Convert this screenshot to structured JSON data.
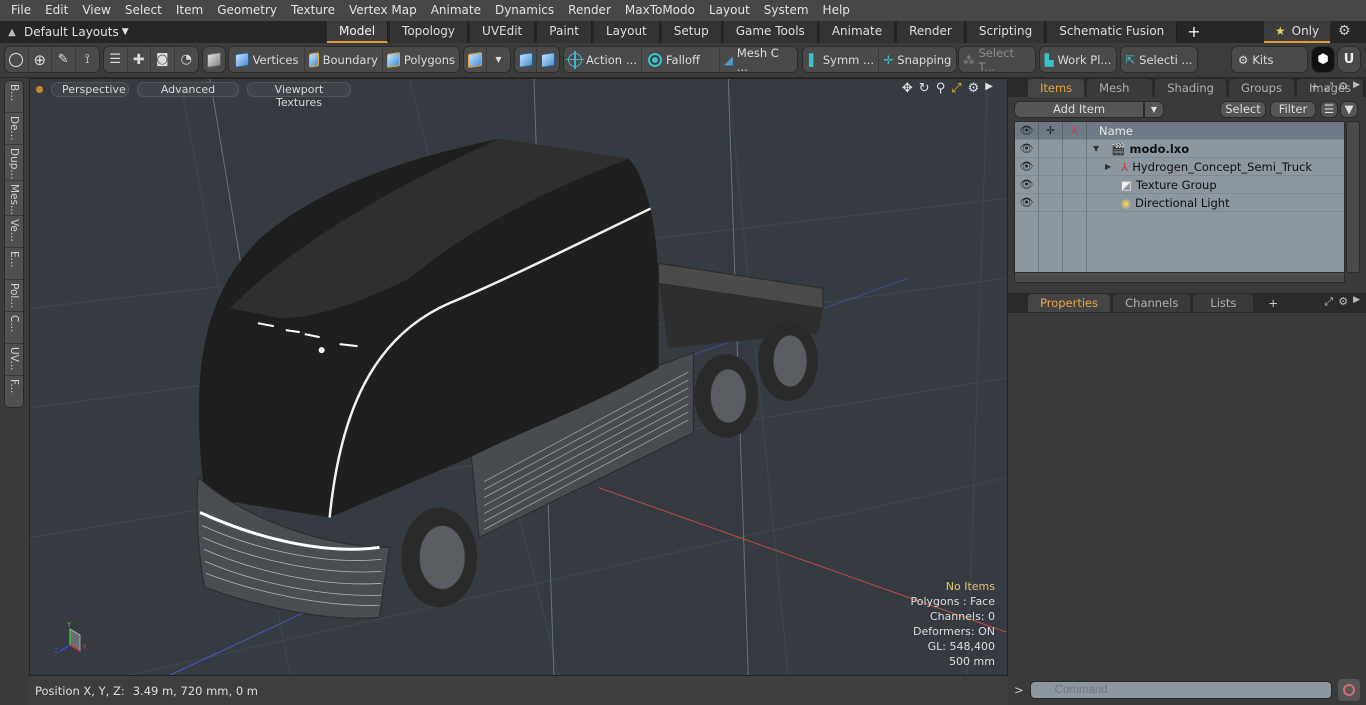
{
  "menu": [
    "File",
    "Edit",
    "View",
    "Select",
    "Item",
    "Geometry",
    "Texture",
    "Vertex Map",
    "Animate",
    "Dynamics",
    "Render",
    "MaxToModo",
    "Layout",
    "System",
    "Help"
  ],
  "layoutbar": {
    "layout_select": "Default Layouts",
    "tabs": [
      {
        "label": "Model",
        "active": true
      },
      {
        "label": "Topology"
      },
      {
        "label": "UVEdit"
      },
      {
        "label": "Paint"
      },
      {
        "label": "Layout"
      },
      {
        "label": "Setup"
      },
      {
        "label": "Game Tools"
      },
      {
        "label": "Animate"
      },
      {
        "label": "Render"
      },
      {
        "label": "Scripting"
      },
      {
        "label": "Schematic Fusion"
      }
    ],
    "add_tab": "+",
    "only_label": "Only"
  },
  "toolbar": {
    "vertices": "Vertices",
    "boundary": "Boundary",
    "polygons": "Polygons",
    "action": "Action",
    "action_more": "...",
    "falloff": "Falloff",
    "mesh": "Mesh C ...",
    "symmetry": "Symm ...",
    "snapping": "Snapping",
    "select_through": "Select T...",
    "work_plane": "Work Pl...",
    "selection": "Selecti ...",
    "kits": "Kits"
  },
  "left_tabs": [
    "B...",
    "De...",
    "Dup...",
    "Mes...",
    "Ve...",
    "E...",
    "Pol...",
    "C...",
    "UV...",
    "F..."
  ],
  "viewport": {
    "perspective": "Perspective",
    "advanced": "Advanced",
    "textures": "Viewport Textures",
    "info": {
      "selection": "No Items",
      "polygons": "Polygons : Face",
      "channels": "Channels: 0",
      "deformers": "Deformers: ON",
      "gl": "GL: 548,400",
      "scale": "500 mm"
    },
    "axis_labels": {
      "x": "X",
      "y": "Y",
      "z": "Z"
    }
  },
  "statusbar": {
    "position_label": "Position X, Y, Z:",
    "position_value": "3.49 m, 720 mm, 0 m"
  },
  "items_panel": {
    "tabs": [
      {
        "label": "Items",
        "active": true
      },
      {
        "label": "Mesh ..."
      },
      {
        "label": "Shading"
      },
      {
        "label": "Groups"
      },
      {
        "label": "Images"
      }
    ],
    "add_item": "Add Item",
    "select": "Select",
    "filter": "Filter",
    "column_name": "Name",
    "rows": [
      {
        "name": "modo.lxo",
        "icon": "scene-icon",
        "bold": true,
        "indent": 0,
        "expand": "▼"
      },
      {
        "name": "Hydrogen_Concept_Semi_Truck",
        "icon": "mesh-locator-icon",
        "indent": 1,
        "expand": "▶"
      },
      {
        "name": "Texture Group",
        "icon": "texture-group-icon",
        "indent": 1,
        "expand": ""
      },
      {
        "name": "Directional Light",
        "icon": "light-icon",
        "indent": 1,
        "expand": ""
      }
    ]
  },
  "properties_panel": {
    "tabs": [
      {
        "label": "Properties",
        "active": true
      },
      {
        "label": "Channels"
      },
      {
        "label": "Lists"
      }
    ]
  },
  "command": {
    "prompt": ">",
    "placeholder": "Command"
  },
  "colors": {
    "accent": "#e69b3a",
    "viewport_bg": "#353b41",
    "list_bg": "#8d97a0"
  }
}
